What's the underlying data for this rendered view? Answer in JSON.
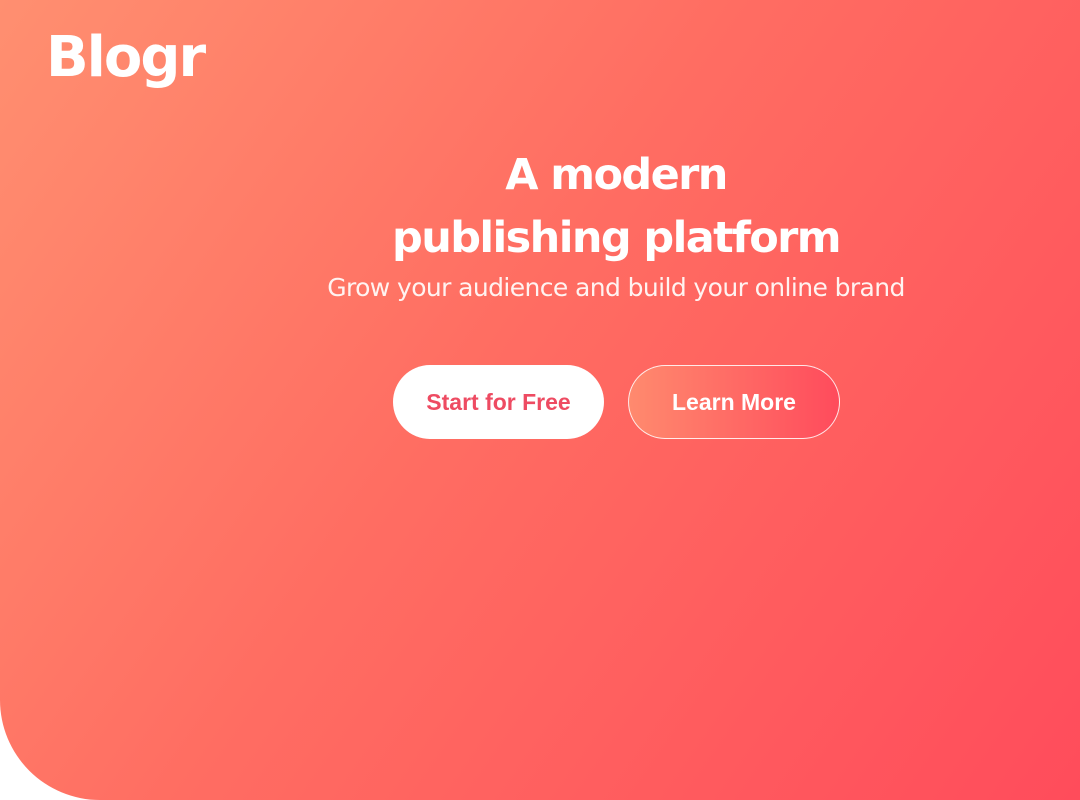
{
  "brand": {
    "logo_text": "Blogr"
  },
  "hero": {
    "headline_line1": "A modern",
    "headline_line2": "publishing platform",
    "subheadline": "Grow your audience and build your online brand",
    "primary_button_label": "Start for Free",
    "secondary_button_label": "Learn More"
  },
  "colors": {
    "gradient_start": "#ff8f70",
    "gradient_end": "#ff4c5b",
    "primary_button_text": "#ee4b62"
  }
}
